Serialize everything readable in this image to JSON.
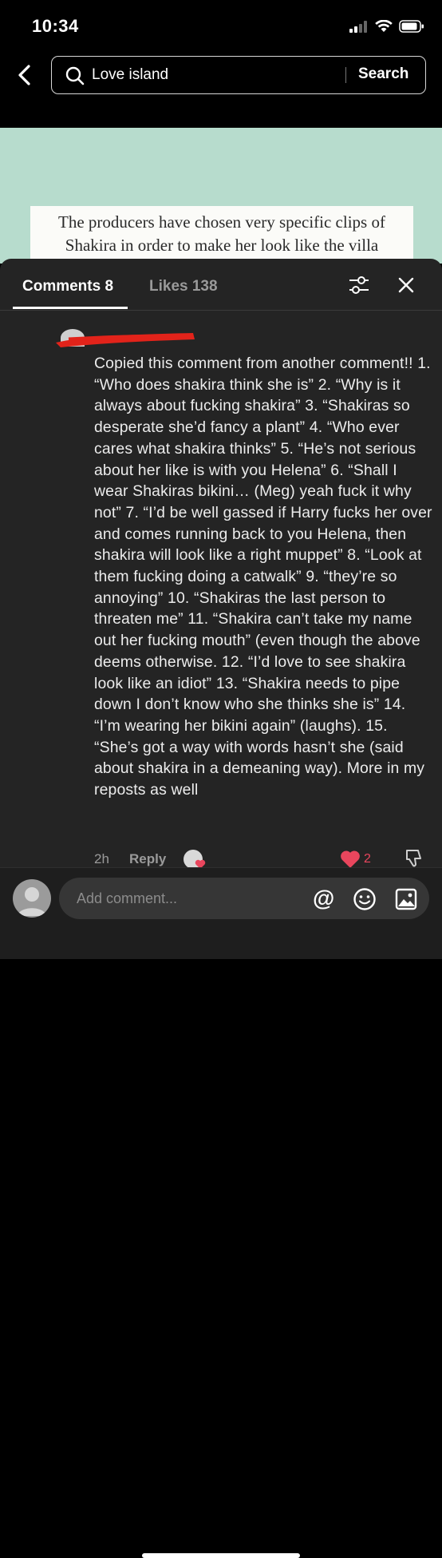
{
  "status_bar": {
    "time": "10:34"
  },
  "search": {
    "query": "Love island",
    "button_label": "Search"
  },
  "preview": {
    "caption_line1": "The producers have chosen very specific clips of",
    "caption_line2": "Shakira in order to make her look like the villa"
  },
  "tabs": {
    "comments_label": "Comments 8",
    "likes_label": "Likes 138"
  },
  "comment": {
    "text": "Copied this comment from another comment!! 1. “Who does shakira think she is” 2. “Why is it always about fucking shakira” 3. “Shakiras so desperate she’d fancy a plant” 4. “Who ever cares what shakira thinks” 5. “He’s not serious about her like is with you Helena” 6. “Shall I wear Shakiras bikini… (Meg) yeah fuck it why not” 7. “I’d be well gassed if Harry fucks her over and comes running back to you Helena, then shakira will look like a right muppet” 8. “Look at them fucking doing a catwalk” 9. “they’re so annoying” 10. “Shakiras the last person to threaten me” 11. “Shakira can’t take my name out her fucking mouth” (even though the above deems otherwise. 12. “I’d love to see shakira look like an idiot” 13. “Shakira needs to pipe down I don’t know who she thinks she is” 14. “I’m wearing her bikini again” (laughs). 15. “She’s got a way with words hasn’t she (said about shakira in a demeaning way). More in my reposts as well",
    "time": "2h",
    "reply_label": "Reply",
    "like_count": "2"
  },
  "input": {
    "placeholder": "Add comment...",
    "at_symbol": "@"
  },
  "colors": {
    "accent_like": "#e9465d",
    "preview_bg": "#b7dccd",
    "sheet_bg": "#242424"
  }
}
